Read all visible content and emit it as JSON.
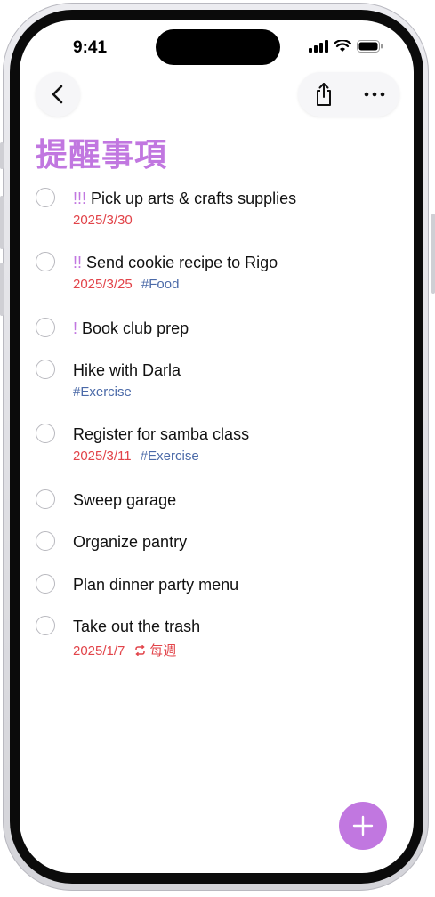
{
  "status_bar": {
    "time": "9:41"
  },
  "toolbar": {
    "back_icon": "chevron-left-icon",
    "share_icon": "share-icon",
    "more_icon": "ellipsis-icon"
  },
  "list": {
    "title": "提醒事項",
    "accent_color": "#c177e0",
    "items": [
      {
        "priority": "!!!",
        "title": "Pick up arts & crafts supplies",
        "date": "2025/3/30",
        "tag": ""
      },
      {
        "priority": "!!",
        "title": "Send cookie recipe to Rigo",
        "date": "2025/3/25",
        "tag": "#Food"
      },
      {
        "priority": "!",
        "title": "Book club prep",
        "date": "",
        "tag": ""
      },
      {
        "priority": "",
        "title": "Hike with Darla",
        "date": "",
        "tag": "#Exercise"
      },
      {
        "priority": "",
        "title": "Register for samba class",
        "date": "2025/3/11",
        "tag": "#Exercise"
      },
      {
        "priority": "",
        "title": "Sweep garage",
        "date": "",
        "tag": ""
      },
      {
        "priority": "",
        "title": "Organize pantry",
        "date": "",
        "tag": ""
      },
      {
        "priority": "",
        "title": "Plan dinner party menu",
        "date": "",
        "tag": ""
      },
      {
        "priority": "",
        "title": "Take out the trash",
        "date": "2025/1/7",
        "tag": "",
        "repeat": "每週"
      }
    ]
  },
  "colors": {
    "date": "#e2444a",
    "tag": "#4b6aa8"
  },
  "add_button_icon": "plus-icon"
}
